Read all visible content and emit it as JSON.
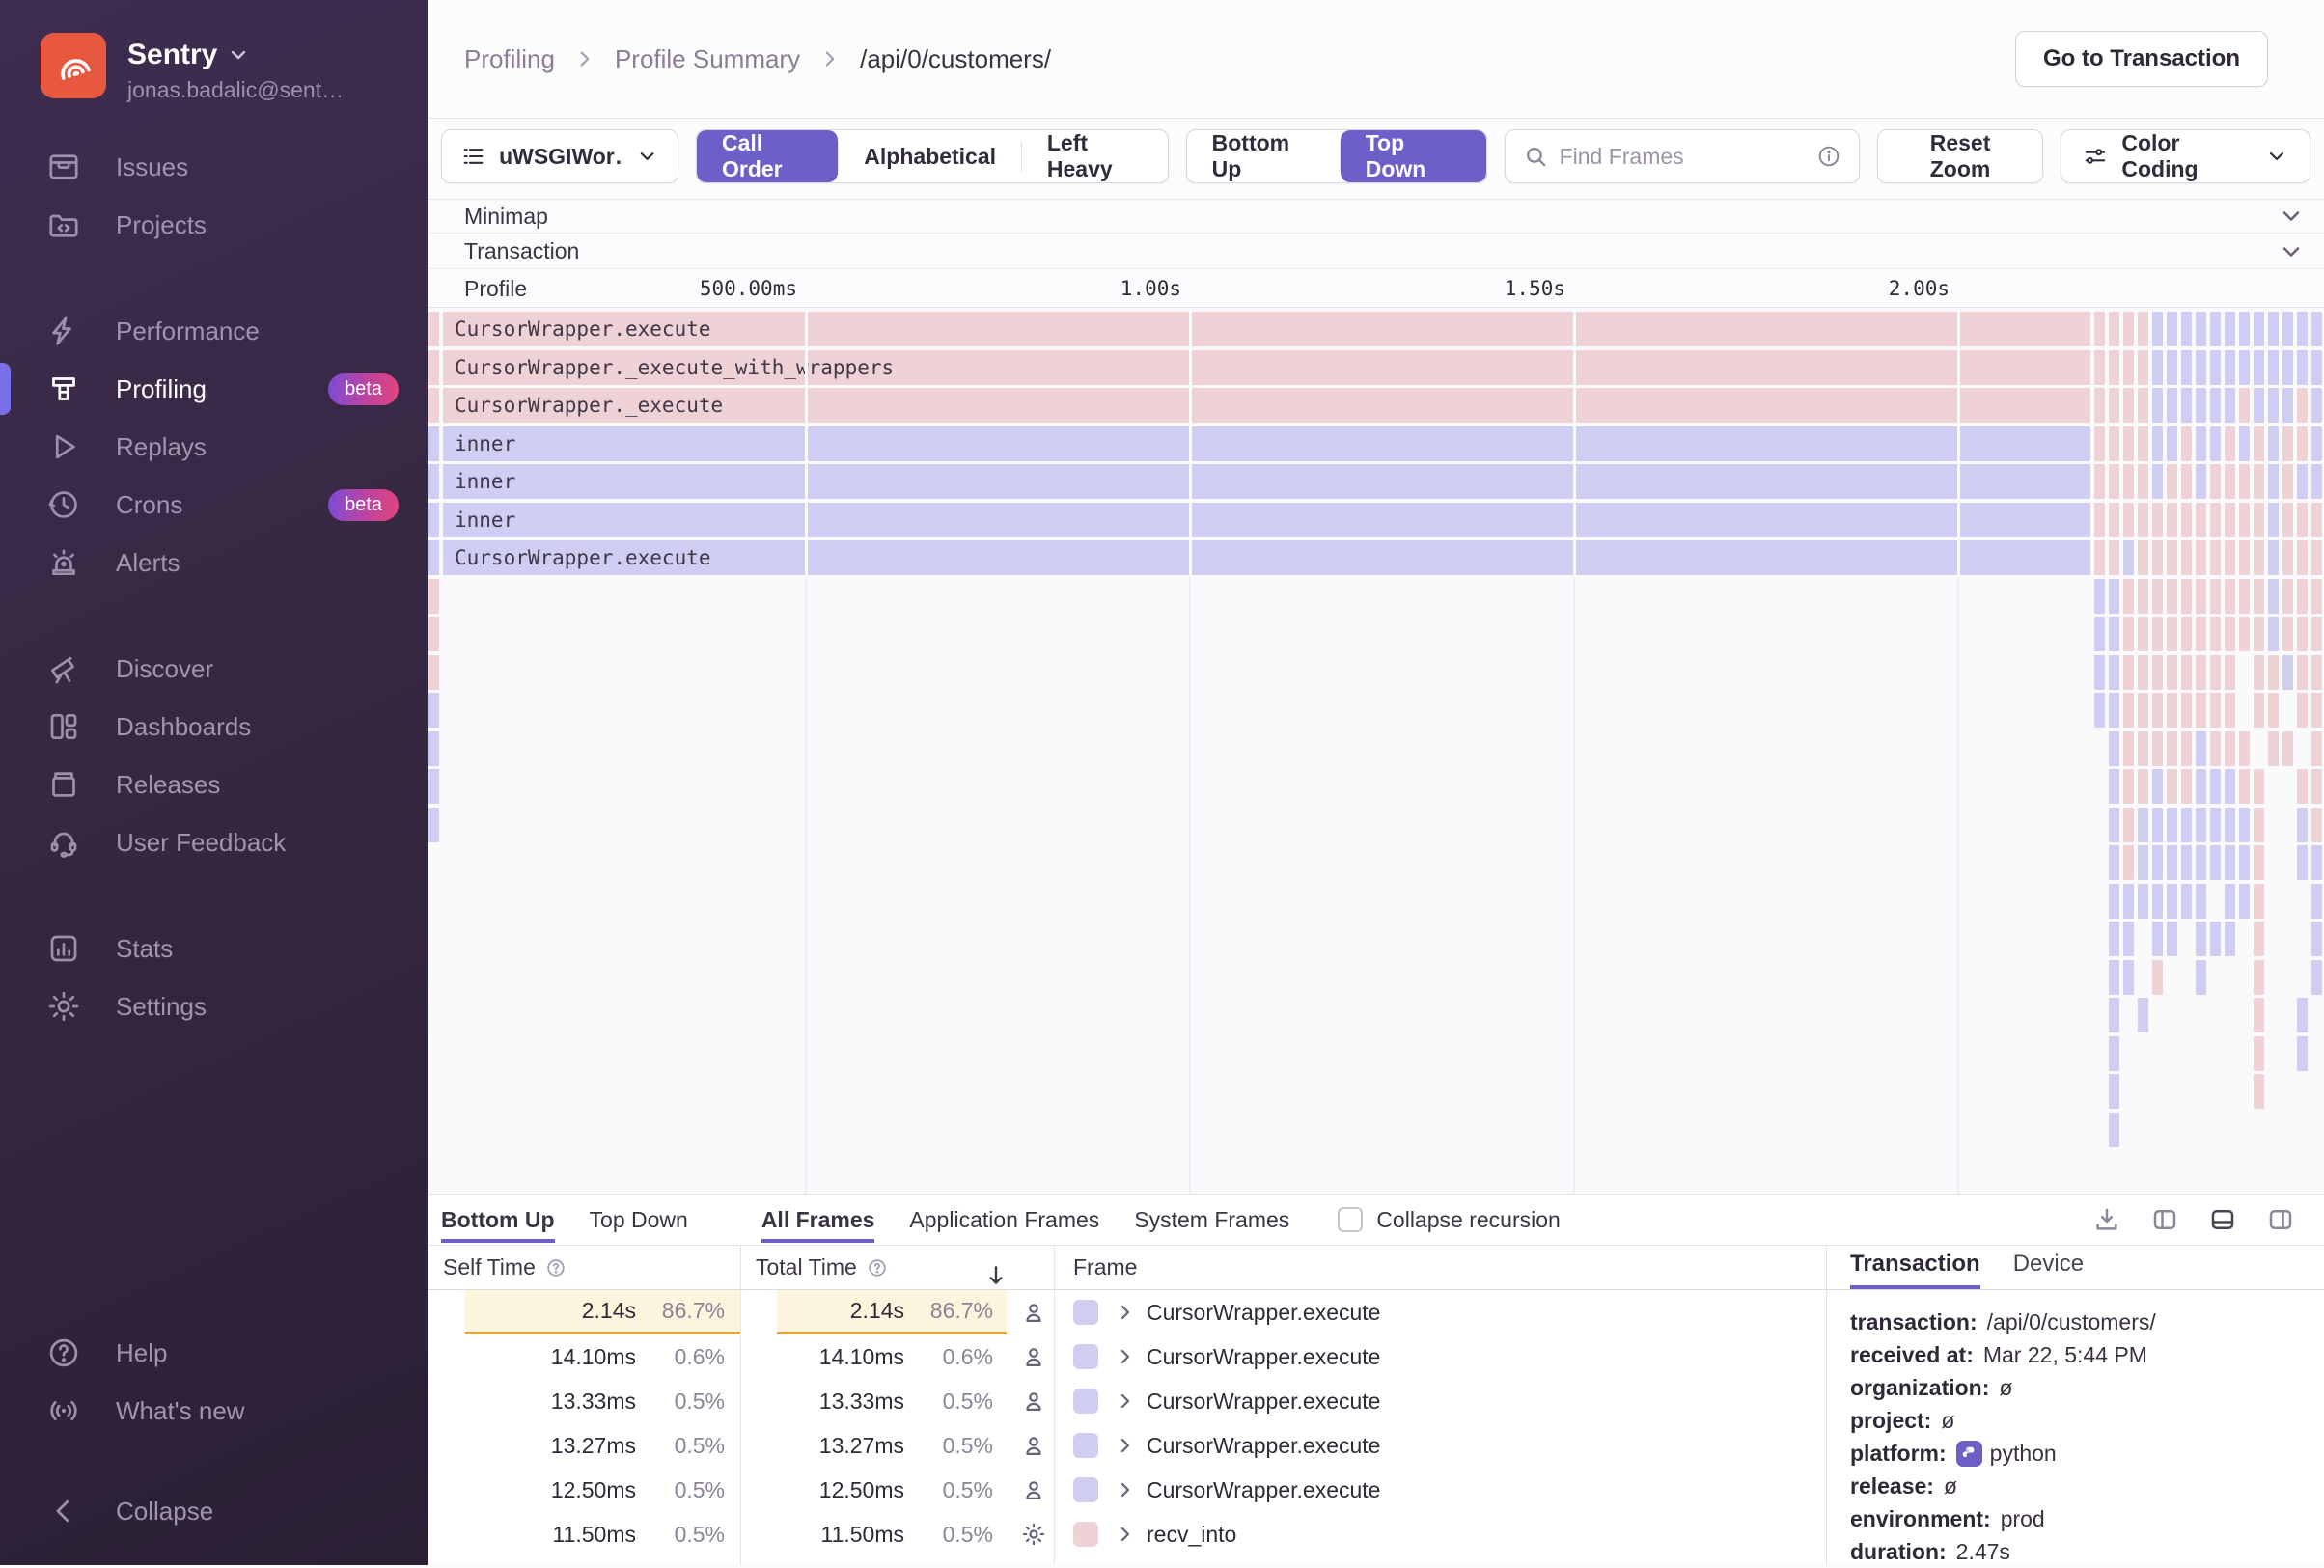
{
  "sidebar": {
    "org": "Sentry",
    "email": "jonas.badalic@sent…",
    "items": [
      {
        "label": "Issues",
        "icon": "issues-icon",
        "sec": 0
      },
      {
        "label": "Projects",
        "icon": "projects-icon",
        "sec": 0
      },
      {
        "label": "Performance",
        "icon": "performance-icon",
        "sec": 1
      },
      {
        "label": "Profiling",
        "icon": "profiling-icon",
        "sec": 1,
        "active": true,
        "badge": "beta"
      },
      {
        "label": "Replays",
        "icon": "replays-icon",
        "sec": 1
      },
      {
        "label": "Crons",
        "icon": "crons-icon",
        "sec": 1,
        "badge": "beta"
      },
      {
        "label": "Alerts",
        "icon": "alerts-icon",
        "sec": 1
      },
      {
        "label": "Discover",
        "icon": "discover-icon",
        "sec": 2
      },
      {
        "label": "Dashboards",
        "icon": "dashboards-icon",
        "sec": 2
      },
      {
        "label": "Releases",
        "icon": "releases-icon",
        "sec": 2
      },
      {
        "label": "User Feedback",
        "icon": "user-feedback-icon",
        "sec": 2
      },
      {
        "label": "Stats",
        "icon": "stats-icon",
        "sec": 3
      },
      {
        "label": "Settings",
        "icon": "settings-icon",
        "sec": 3
      }
    ],
    "footer": [
      {
        "label": "Help",
        "icon": "help-icon"
      },
      {
        "label": "What's new",
        "icon": "whats-new-icon"
      },
      {
        "label": "Collapse",
        "icon": "collapse-icon"
      }
    ]
  },
  "header": {
    "breadcrumbs": [
      "Profiling",
      "Profile Summary",
      "/api/0/customers/"
    ],
    "action": "Go to Transaction"
  },
  "toolbar": {
    "thread": "uWSGIWor…",
    "sort_modes": [
      "Call Order",
      "Alphabetical",
      "Left Heavy"
    ],
    "sort_active": "Call Order",
    "view_modes": [
      "Bottom Up",
      "Top Down"
    ],
    "view_active": "Top Down",
    "search_placeholder": "Find Frames",
    "reset_label": "Reset Zoom",
    "color_label": "Color Coding"
  },
  "flamegraph": {
    "minimap_label": "Minimap",
    "transaction_label": "Transaction",
    "profile_label": "Profile",
    "ticks": [
      "500.00ms",
      "1.00s",
      "1.50s",
      "2.00s"
    ],
    "colors": {
      "pink": "#EFD2D5",
      "lavender": "#CFCEF2"
    },
    "rows": [
      {
        "label": "CursorWrapper.execute",
        "color": "pink"
      },
      {
        "label": "CursorWrapper._execute_with_wrappers",
        "color": "pink"
      },
      {
        "label": "CursorWrapper._execute",
        "color": "pink"
      },
      {
        "label": "inner",
        "color": "lavender"
      },
      {
        "label": "inner",
        "color": "lavender"
      },
      {
        "label": "inner",
        "color": "lavender"
      },
      {
        "label": "CursorWrapper.execute",
        "color": "lavender"
      }
    ],
    "left_slivers": [
      "pink",
      "pink",
      "pink",
      "lavender",
      "lavender",
      "lavender",
      "lavender"
    ],
    "dense_pattern": [
      "PPPPPLLLLLLLLLLLL",
      "PPPPPLLLLLLLLLLLL",
      "PPPPPLLLLLLPLLLPL",
      "LPPPPLLPLLPLPLPPL",
      "LPPPPLPPLPPPPLPLL",
      "LPPPPPPPPPPPPLPPP",
      "LPPLPPPPPPPPPLPPP",
      ".LLPPPPPPPPPPLPPP",
      ".LLPPPPPPPPPPLPPP",
      ".LLPPPPPPPP.PPLPP",
      ".LLPPPPPPPP.PP.PP",
      "..LPPPPPLPPP.PP.P",
      "..LPPLPPLLLPP..PP",
      "..LPLLLLLLLLP..LP",
      "..LPLLLLLLLLP..LL",
      "..LLLLLLL.LLP...L",
      "..LL.LL.LLL.P...L",
      "..LL.P..L...P...L",
      "..L.L.......P..L.",
      "..L.........P..L.",
      "..L.........P....",
      "..L.............."
    ]
  },
  "bottom_panel": {
    "view_tabs": [
      "Bottom Up",
      "Top Down"
    ],
    "view_active": "Bottom Up",
    "frame_tabs": [
      "All Frames",
      "Application Frames",
      "System Frames"
    ],
    "frame_active": "All Frames",
    "checkbox_label": "Collapse recursion",
    "table": {
      "headers": {
        "self": "Self Time",
        "total": "Total Time",
        "frame": "Frame"
      },
      "rows": [
        {
          "self": "2.14s",
          "self_pct": "86.7%",
          "total": "2.14s",
          "total_pct": "86.7%",
          "icon": "user",
          "color": "lavender",
          "frame": "CursorWrapper.execute",
          "highlight": true
        },
        {
          "self": "14.10ms",
          "self_pct": "0.6%",
          "total": "14.10ms",
          "total_pct": "0.6%",
          "icon": "user",
          "color": "lavender",
          "frame": "CursorWrapper.execute"
        },
        {
          "self": "13.33ms",
          "self_pct": "0.5%",
          "total": "13.33ms",
          "total_pct": "0.5%",
          "icon": "user",
          "color": "lavender",
          "frame": "CursorWrapper.execute"
        },
        {
          "self": "13.27ms",
          "self_pct": "0.5%",
          "total": "13.27ms",
          "total_pct": "0.5%",
          "icon": "user",
          "color": "lavender",
          "frame": "CursorWrapper.execute"
        },
        {
          "self": "12.50ms",
          "self_pct": "0.5%",
          "total": "12.50ms",
          "total_pct": "0.5%",
          "icon": "user",
          "color": "lavender",
          "frame": "CursorWrapper.execute"
        },
        {
          "self": "11.50ms",
          "self_pct": "0.5%",
          "total": "11.50ms",
          "total_pct": "0.5%",
          "icon": "gear",
          "color": "pink",
          "frame": "recv_into"
        }
      ]
    },
    "details": {
      "tabs": [
        "Transaction",
        "Device"
      ],
      "active": "Transaction",
      "fields": [
        {
          "label": "transaction:",
          "value": "/api/0/customers/"
        },
        {
          "label": "received at:",
          "value": "Mar 22, 5:44 PM"
        },
        {
          "label": "organization:",
          "value": "ø"
        },
        {
          "label": "project:",
          "value": "ø"
        },
        {
          "label": "platform:",
          "value": "python",
          "icon": "python-icon"
        },
        {
          "label": "release:",
          "value": "ø"
        },
        {
          "label": "environment:",
          "value": "prod"
        },
        {
          "label": "duration:",
          "value": "2.47s"
        }
      ]
    }
  }
}
